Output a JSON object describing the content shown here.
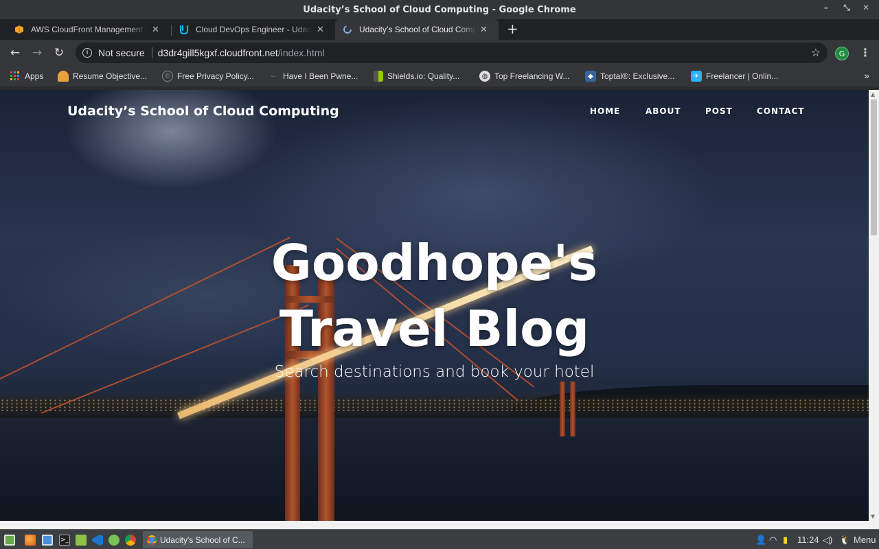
{
  "window": {
    "title": "Udacity’s School of Cloud Computing - Google Chrome",
    "controls": [
      "minimize-icon",
      "restore-icon",
      "close-icon"
    ]
  },
  "tabs": [
    {
      "title": "AWS CloudFront Management Console",
      "icon": "aws-icon",
      "active": false
    },
    {
      "title": "Cloud DevOps Engineer - Udacity",
      "icon": "udacity-icon",
      "active": false
    },
    {
      "title": "Udacity’s School of Cloud Computing",
      "icon": "loading-icon",
      "active": true
    }
  ],
  "toolbar": {
    "security_label": "Not secure",
    "url_host": "d3dr4gill5kgxf.cloudfront.net",
    "url_path": "/index.html",
    "profile_initial": "G"
  },
  "bookmarks": [
    {
      "label": "Apps",
      "icon": "apps-grid-icon"
    },
    {
      "label": "Resume Objective...",
      "icon": "resume-icon"
    },
    {
      "label": "Free Privacy Policy...",
      "icon": "privacy-icon"
    },
    {
      "label": "Have I Been Pwne...",
      "icon": "pwned-icon"
    },
    {
      "label": "Shields.io: Quality...",
      "icon": "shields-icon"
    },
    {
      "label": "Top Freelancing W...",
      "icon": "globe-icon"
    },
    {
      "label": "Toptal®: Exclusive...",
      "icon": "toptal-icon"
    },
    {
      "label": "Freelancer | Onlin...",
      "icon": "freelancer-icon"
    }
  ],
  "site": {
    "brand": "Udacity’s School of Cloud Computing",
    "nav": [
      "HOME",
      "ABOUT",
      "POST",
      "CONTACT"
    ],
    "hero_title_line1": "Goodhope's",
    "hero_title_line2": "Travel Blog",
    "hero_subtitle": "Search destinations and book your hotel"
  },
  "taskbar": {
    "window_label": "Udacity's School of C...",
    "clock": "11:24",
    "menu_label": "Menu"
  },
  "colors": {
    "chrome_dark": "#202124",
    "chrome_toolbar": "#35363a",
    "profile_green": "#1e8e3e",
    "taskbar": "#3c3f41"
  }
}
